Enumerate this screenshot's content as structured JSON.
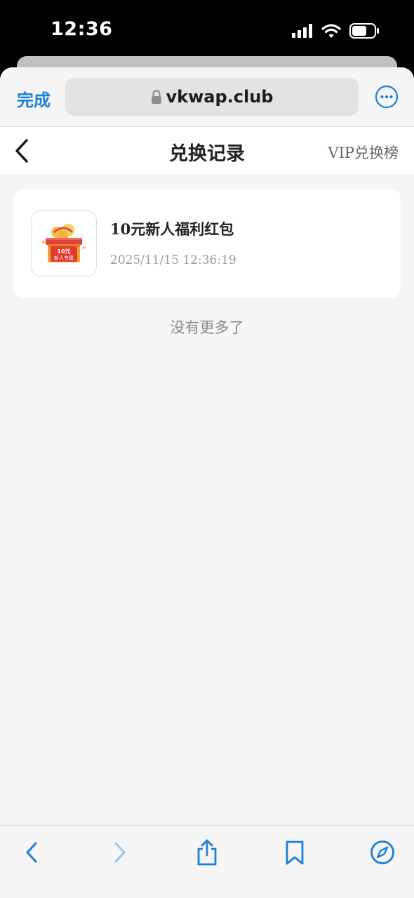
{
  "status_bar": {
    "time": "12:36",
    "icons": [
      "signal-icon",
      "wifi-icon",
      "battery-icon"
    ]
  },
  "browser": {
    "done_label": "完成",
    "url": "vkwap.club",
    "accent_color": "#1a7fd8",
    "toolbar_icons": [
      "back-icon",
      "forward-icon",
      "share-icon",
      "bookmarks-icon",
      "compass-icon"
    ]
  },
  "page": {
    "title": "兑换记录",
    "vip_link": "VIP兑换榜",
    "records": [
      {
        "title": "10元新人福利红包",
        "time": "2025/11/15 12:36:19",
        "thumb_line1": "10元",
        "thumb_line2": "新人专属"
      }
    ],
    "no_more": "没有更多了"
  }
}
